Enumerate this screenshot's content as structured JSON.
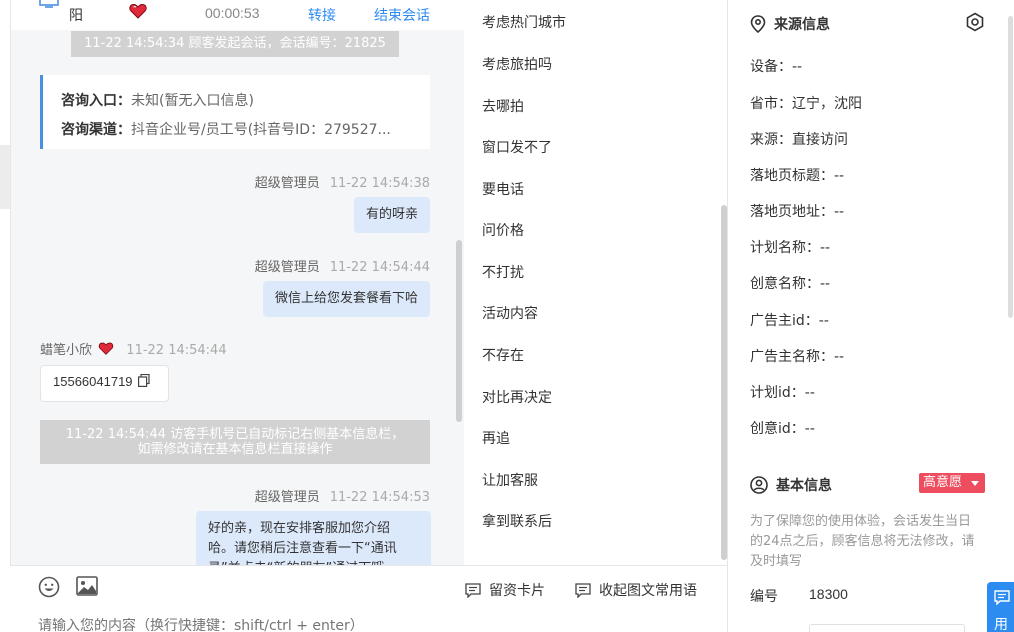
{
  "header": {
    "visitor_name": "阳",
    "timer": "00:00:53",
    "transfer_label": "转接",
    "end_label": "结束会话"
  },
  "chat": {
    "session_start": "11-22 14:54:34 顾客发起会话，会话编号：21825",
    "entry_label": "咨询入口：",
    "entry_value": "未知(暂无入口信息)",
    "channel_label": "咨询渠道：",
    "channel_value": "抖音企业号/员工号(抖音号ID：279527...",
    "messages": [
      {
        "sender": "超级管理员",
        "time": "11-22 14:54:38",
        "text": "有的呀亲"
      },
      {
        "sender": "超级管理员",
        "time": "11-22 14:54:44",
        "text": "微信上给您发套餐看下哈"
      },
      {
        "sender": "蜡笔小欣",
        "time": "11-22 14:54:44",
        "text": "15566041719"
      },
      {
        "sender": "超级管理员",
        "time": "11-22 14:54:53",
        "line1": "好的亲，现在安排客服加您介绍",
        "line2": "哈。请您稍后注意查看一下“通讯",
        "line3": "录”並点击“新的朋友”通过下哦"
      }
    ],
    "auto_mark_line1": "11-22 14:54:44 访客手机号已自动标记右侧基本信息栏，",
    "auto_mark_line2": "如需修改请在基本信息栏直接操作"
  },
  "composer": {
    "card_label": "留资卡片",
    "collapse_label": "收起图文常用语",
    "placeholder": "请输入您的内容（换行快捷键：shift/ctrl + enter）"
  },
  "phrases": [
    "考虑热门城市",
    "考虑旅拍吗",
    "去哪拍",
    "窗口发不了",
    "要电话",
    "问价格",
    "不打扰",
    "活动内容",
    "不存在",
    "对比再决定",
    "再追",
    "让加客服",
    "拿到联系后"
  ],
  "source_info": {
    "title": "来源信息",
    "rows": [
      "设备：--",
      "省市：辽宁，沈阳",
      "来源：直接访问",
      "落地页标题：--",
      "落地页地址：--",
      "计划名称：--",
      "创意名称：--",
      "广告主id：--",
      "广告主名称：--",
      "计划id：--",
      "创意id：--"
    ]
  },
  "basic_info": {
    "title": "基本信息",
    "intent_tag": "高意愿",
    "notice": "为了保障您的使用体验，会话发生当日的24点之后，顾客信息将无法修改，请及时填写",
    "id_label": "编号",
    "id_value": "18300"
  },
  "float_button": {
    "label": "用"
  },
  "colors": {
    "accent": "#2d8cf0",
    "tag_red": "#ee4c5f",
    "bubble_blue": "#dce9fb"
  }
}
